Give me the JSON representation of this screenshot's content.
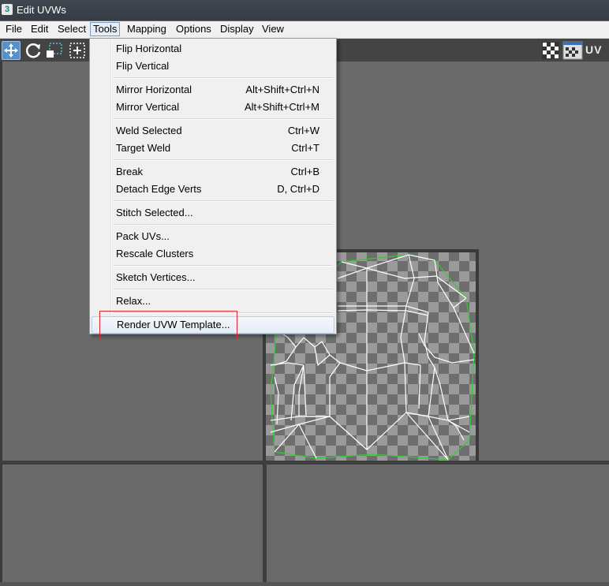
{
  "window": {
    "title": "Edit UVWs",
    "app_icon": "3"
  },
  "menubar": [
    "File",
    "Edit",
    "Select",
    "Tools",
    "Mapping",
    "Options",
    "Display",
    "View"
  ],
  "toolbar": {
    "uv_label": "UV"
  },
  "tools_menu": {
    "items": [
      {
        "label": "Flip Horizontal",
        "shortcut": ""
      },
      {
        "label": "Flip Vertical",
        "shortcut": ""
      },
      {
        "label": "Mirror Horizontal",
        "shortcut": "Alt+Shift+Ctrl+N"
      },
      {
        "label": "Mirror Vertical",
        "shortcut": "Alt+Shift+Ctrl+M"
      },
      {
        "label": "Weld Selected",
        "shortcut": "Ctrl+W"
      },
      {
        "label": "Target Weld",
        "shortcut": "Ctrl+T"
      },
      {
        "label": "Break",
        "shortcut": "Ctrl+B"
      },
      {
        "label": "Detach Edge Verts",
        "shortcut": "D, Ctrl+D"
      },
      {
        "label": "Stitch Selected...",
        "shortcut": ""
      },
      {
        "label": "Pack UVs...",
        "shortcut": ""
      },
      {
        "label": "Rescale Clusters",
        "shortcut": ""
      },
      {
        "label": "Sketch Vertices...",
        "shortcut": ""
      },
      {
        "label": "Relax...",
        "shortcut": ""
      },
      {
        "label": "Render UVW Template...",
        "shortcut": ""
      }
    ],
    "highlighted": "Render UVW Template..."
  },
  "colors": {
    "accent": "#5a90c8",
    "highlight_box": "#e0262b",
    "uv_border": "#33cc33"
  }
}
